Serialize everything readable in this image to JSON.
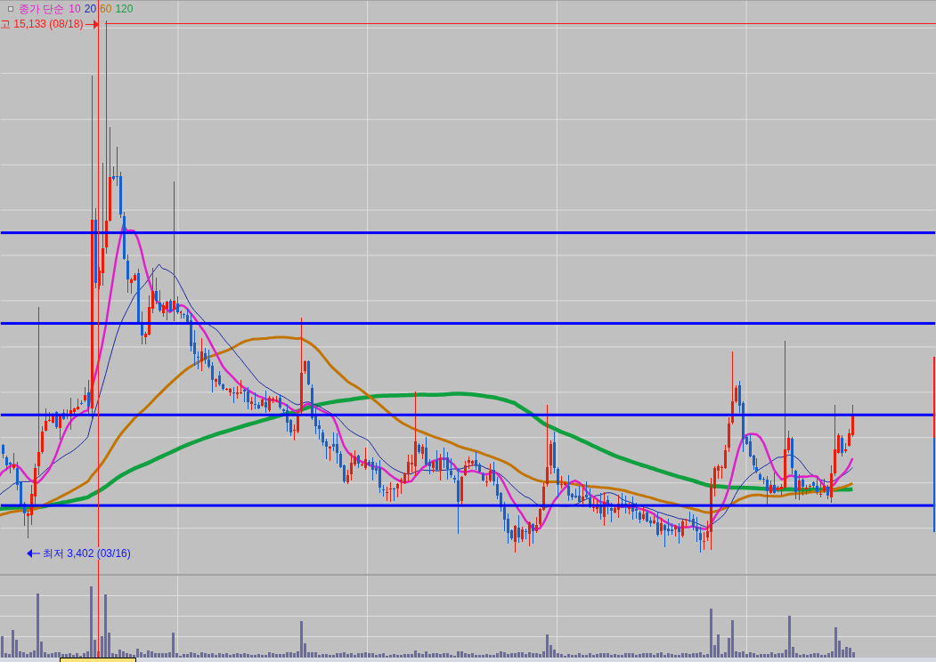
{
  "legend": {
    "label": "종가 단순",
    "averages": [
      {
        "period": "10",
        "color": "#e020c8"
      },
      {
        "period": "20",
        "color": "#1a2aa0"
      },
      {
        "period": "60",
        "color": "#c27400"
      },
      {
        "period": "120",
        "color": "#10a040"
      }
    ]
  },
  "high_marker": {
    "text": "고 15,133 (08/18)"
  },
  "low_marker": {
    "text": "최저 3,402 (03/16)"
  }
}
